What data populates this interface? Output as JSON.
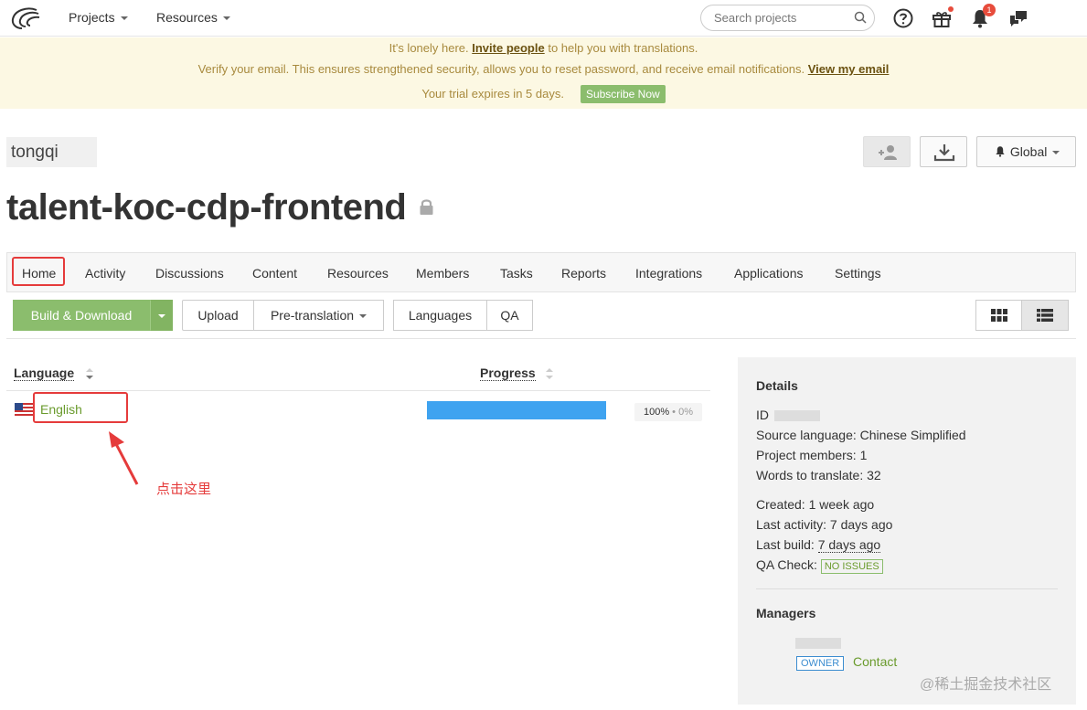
{
  "nav": {
    "projects_label": "Projects",
    "resources_label": "Resources",
    "search_placeholder": "Search projects",
    "notifications_count": "1"
  },
  "banner": {
    "line1_prefix": "It's lonely here. ",
    "line1_link": "Invite people",
    "line1_suffix": " to help you with translations.",
    "line2_text": "Verify your email. This ensures strengthened security, allows you to reset password, and receive email notifications. ",
    "line2_link": "View my email",
    "line3_text": "Your trial expires in 5 days.",
    "subscribe_label": "Subscribe Now"
  },
  "org_name": "tongqi",
  "global_label": "Global",
  "project_title": "talent-koc-cdp-frontend",
  "tabs": [
    "Home",
    "Activity",
    "Discussions",
    "Content",
    "Resources",
    "Members",
    "Tasks",
    "Reports",
    "Integrations",
    "Applications",
    "Settings"
  ],
  "toolbar": {
    "build_label": "Build & Download",
    "upload_label": "Upload",
    "pretranslation_label": "Pre-translation",
    "languages_label": "Languages",
    "qa_label": "QA"
  },
  "table": {
    "language_header": "Language",
    "progress_header": "Progress",
    "rows": [
      {
        "language": "English",
        "progress": 1.0,
        "translated": "100%",
        "sep": " • ",
        "approved": "0%"
      }
    ]
  },
  "annotation_text": "点击这里",
  "details": {
    "heading": "Details",
    "id_label": "ID",
    "source_language": "Source language: Chinese Simplified",
    "project_members": "Project members: 1",
    "words_to_translate": "Words to translate: 32",
    "created": "Created: 1 week ago",
    "last_activity": "Last activity: 7 days ago",
    "last_build_label": "Last build: ",
    "last_build_value": "7 days ago",
    "qa_check_label": "QA Check: ",
    "qa_check_value": "NO ISSUES",
    "managers_heading": "Managers",
    "owner_badge": "OWNER",
    "contact_label": "Contact"
  },
  "watermark": "@稀土掘金技术社区",
  "colors": {
    "accent_green": "#8bbd6d",
    "progress_blue": "#3fa3f0",
    "annotation_red": "#e53b3b",
    "banner_bg": "#fcf8e3"
  }
}
